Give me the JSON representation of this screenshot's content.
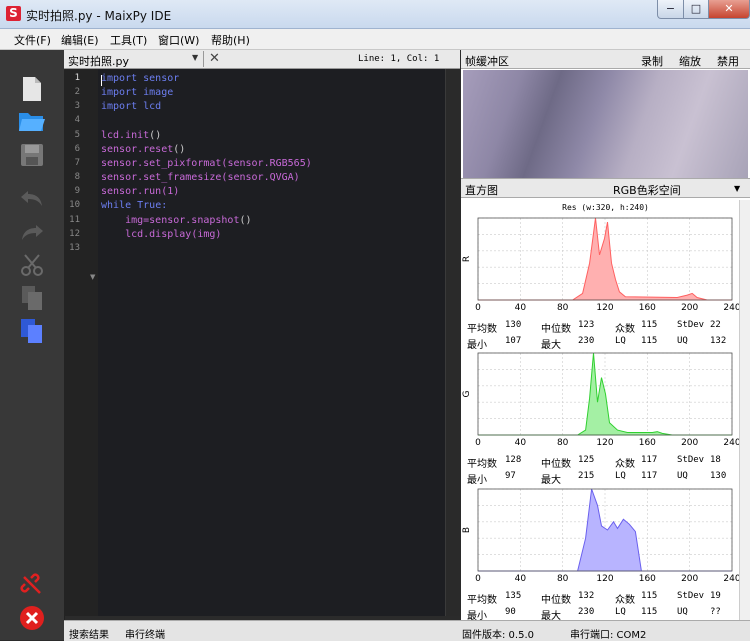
{
  "window": {
    "title": "实时拍照.py - MaixPy IDE",
    "app_icon": "S",
    "min": "−",
    "max": "□",
    "close": "✕"
  },
  "menu": [
    "文件(F)",
    "编辑(E)",
    "工具(T)",
    "窗口(W)",
    "帮助(H)"
  ],
  "tools": [
    "new-file-icon",
    "open-folder-icon",
    "save-icon",
    "undo-icon",
    "redo-icon",
    "cut-icon",
    "copy-icon",
    "paste-icon",
    "connect-icon",
    "stop-icon"
  ],
  "editor": {
    "tab": "实时拍照.py",
    "line_info": "Line: 1, Col: 1",
    "lines": [
      [
        [
          "import",
          "#6c7ef0"
        ],
        [
          " sensor",
          "#6c7ef0"
        ]
      ],
      [
        [
          "import",
          "#6c7ef0"
        ],
        [
          " image",
          "#6c7ef0"
        ]
      ],
      [
        [
          "import",
          "#6c7ef0"
        ],
        [
          " lcd",
          "#6c7ef0"
        ]
      ],
      [],
      [
        [
          "lcd.init",
          "#c86ad8"
        ],
        [
          "()",
          "#cccccc"
        ]
      ],
      [
        [
          "sensor.reset",
          "#c86ad8"
        ],
        [
          "()",
          "#cccccc"
        ]
      ],
      [
        [
          "sensor.set_pixformat",
          "#c86ad8"
        ],
        [
          "(sensor.RGB565)",
          "#c86ad8"
        ]
      ],
      [
        [
          "sensor.set_framesize",
          "#c86ad8"
        ],
        [
          "(sensor.QVGA)",
          "#c86ad8"
        ]
      ],
      [
        [
          "sensor.run",
          "#c86ad8"
        ],
        [
          "(1)",
          "#c86ad8"
        ]
      ],
      [
        [
          "while",
          "#6c7ef0"
        ],
        [
          " True:",
          "#6c7ef0"
        ]
      ],
      [
        [
          "    img=sensor.snapshot",
          "#c86ad8"
        ],
        [
          "()",
          "#cccccc"
        ]
      ],
      [
        [
          "    lcd.display",
          "#c86ad8"
        ],
        [
          "(img)",
          "#c86ad8"
        ]
      ],
      []
    ]
  },
  "framebuffer": {
    "title": "帧缓冲区",
    "record": "录制",
    "zoom": "缩放",
    "disable": "禁用"
  },
  "histogram": {
    "title": "直方图",
    "colorspace": "RGB色彩空间",
    "res": "Res (w:320, h:240)",
    "x_ticks": [
      "0",
      "40",
      "80",
      "120",
      "160",
      "200",
      "240"
    ],
    "channels": [
      {
        "label": "R",
        "fill": "#ffb0b0",
        "stroke": "#ff6060",
        "points": [
          [
            0,
            0
          ],
          [
            95,
            0
          ],
          [
            105,
            8
          ],
          [
            112,
            45
          ],
          [
            118,
            100
          ],
          [
            122,
            55
          ],
          [
            127,
            75
          ],
          [
            130,
            95
          ],
          [
            134,
            45
          ],
          [
            138,
            25
          ],
          [
            142,
            10
          ],
          [
            148,
            4
          ],
          [
            200,
            3
          ],
          [
            210,
            6
          ],
          [
            215,
            8
          ],
          [
            220,
            3
          ],
          [
            230,
            0
          ],
          [
            255,
            0
          ]
        ],
        "stats": {
          "mean_label": "平均数",
          "mean": "130",
          "median_label": "中位数",
          "median": "123",
          "mode_label": "众数",
          "mode": "115",
          "stdev_label": "StDev",
          "stdev": "22",
          "min_label": "最小",
          "min": "107",
          "max_label": "最大",
          "max": "230",
          "lq_label": "LQ",
          "lq": "115",
          "uq_label": "UQ",
          "uq": "132"
        }
      },
      {
        "label": "G",
        "fill": "#a4f0a4",
        "stroke": "#30d030",
        "points": [
          [
            0,
            0
          ],
          [
            100,
            0
          ],
          [
            108,
            6
          ],
          [
            112,
            45
          ],
          [
            116,
            100
          ],
          [
            120,
            40
          ],
          [
            124,
            70
          ],
          [
            128,
            50
          ],
          [
            132,
            15
          ],
          [
            140,
            6
          ],
          [
            150,
            3
          ],
          [
            175,
            3
          ],
          [
            180,
            4
          ],
          [
            185,
            2
          ],
          [
            195,
            0
          ],
          [
            255,
            0
          ]
        ],
        "stats": {
          "mean_label": "平均数",
          "mean": "128",
          "median_label": "中位数",
          "median": "125",
          "mode_label": "众数",
          "mode": "117",
          "stdev_label": "StDev",
          "stdev": "18",
          "min_label": "最小",
          "min": "97",
          "max_label": "最大",
          "max": "215",
          "lq_label": "LQ",
          "lq": "117",
          "uq_label": "UQ",
          "uq": "130"
        }
      },
      {
        "label": "B",
        "fill": "#b8b4ff",
        "stroke": "#6a60ee",
        "points": [
          [
            0,
            0
          ],
          [
            100,
            0
          ],
          [
            108,
            40
          ],
          [
            114,
            100
          ],
          [
            120,
            80
          ],
          [
            124,
            55
          ],
          [
            130,
            50
          ],
          [
            136,
            60
          ],
          [
            140,
            52
          ],
          [
            146,
            63
          ],
          [
            152,
            57
          ],
          [
            158,
            48
          ],
          [
            164,
            0
          ],
          [
            255,
            0
          ]
        ],
        "stats": {
          "mean_label": "平均数",
          "mean": "135",
          "median_label": "中位数",
          "median": "132",
          "mode_label": "众数",
          "mode": "115",
          "stdev_label": "StDev",
          "stdev": "19",
          "min_label": "最小",
          "min": "90",
          "max_label": "最大",
          "max": "230",
          "lq_label": "LQ",
          "lq": "115",
          "uq_label": "UQ",
          "uq": "??"
        }
      }
    ]
  },
  "bottom": {
    "search": "搜索结果",
    "serial": "串行终端",
    "fw": "固件版本: 0.5.0",
    "port": "串行端口: COM2"
  }
}
